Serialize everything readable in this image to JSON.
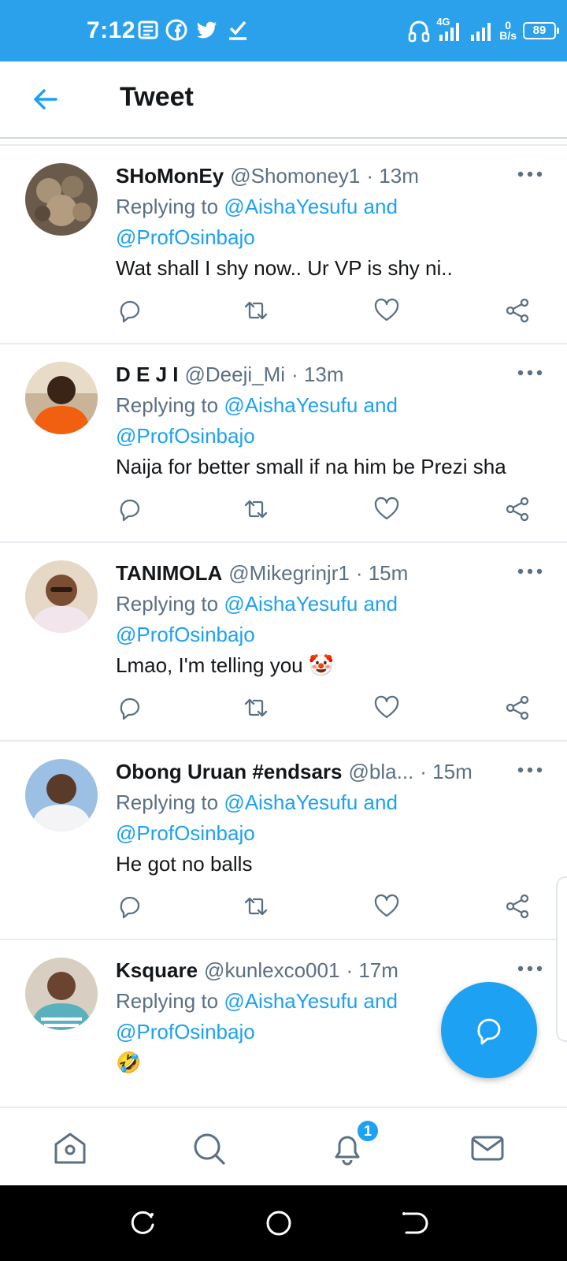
{
  "status_bar": {
    "time": "7:12",
    "network": "4G",
    "data_rate_top": "0",
    "data_rate_bottom": "B/s",
    "battery": "89"
  },
  "header": {
    "title": "Tweet"
  },
  "tweets": [
    {
      "name": "SHoMonEy",
      "handle": "@Shomoney1",
      "time": "· 13m",
      "replying_prefix": "Replying to ",
      "mention1": "@AishaYesufu and",
      "mention2": "@ProfOsinbajo",
      "text": "Wat shall I shy now.. Ur VP is shy ni..",
      "avatar_color": "#7a6a5a"
    },
    {
      "name": "D E J I",
      "handle": "@Deeji_Mi",
      "time": "· 13m",
      "replying_prefix": "Replying to ",
      "mention1": "@AishaYesufu and",
      "mention2": "@ProfOsinbajo",
      "text": "Naija for better small if na him be Prezi sha",
      "avatar_color": "#e05a1a"
    },
    {
      "name": "TANIMOLA",
      "handle": "@Mikegrinjr1",
      "time": "· 15m",
      "replying_prefix": "Replying to ",
      "mention1": "@AishaYesufu and",
      "mention2": "@ProfOsinbajo",
      "text": "Lmao, I'm telling you 🤡",
      "avatar_color": "#c9a88a"
    },
    {
      "name": "Obong Uruan #endsars",
      "handle": "@bla...",
      "time": "· 15m",
      "replying_prefix": "Replying to ",
      "mention1": "@AishaYesufu and",
      "mention2": "@ProfOsinbajo",
      "text": "He got no balls",
      "avatar_color": "#8fb3d9"
    },
    {
      "name": "Ksquare",
      "handle": "@kunlexco001",
      "time": "· 17m",
      "replying_prefix": "Replying to ",
      "mention1": "@AishaYesufu and",
      "mention2": "@ProfOsinbajo",
      "text": "🤣",
      "avatar_color": "#5aa7b5"
    }
  ],
  "bottom_nav": {
    "items": [
      "home-icon",
      "search-icon",
      "notifications-icon",
      "messages-icon"
    ],
    "notification_badge": "1"
  },
  "colors": {
    "status_bar": "#2aa1ea",
    "accent": "#1da1f2",
    "secondary_text": "#5b7083"
  }
}
